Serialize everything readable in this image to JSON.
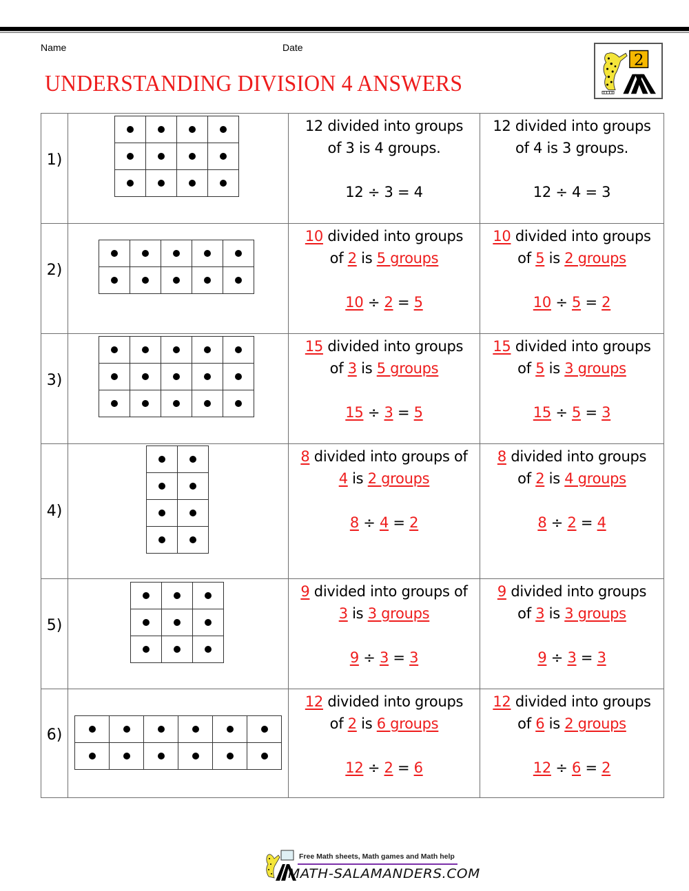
{
  "header": {
    "name_label": "Name",
    "date_label": "Date",
    "title": "UNDERSTANDING DIVISION 4 ANSWERS",
    "title_color": "#ee1c1c",
    "logo_icon": "salamander-math-logo",
    "logo_number": "2"
  },
  "answer_color": "#ee1c1c",
  "problems": [
    {
      "label": "1)",
      "array": {
        "rows": 3,
        "cols": 4
      },
      "answers_highlighted": false,
      "a": {
        "total": "12",
        "group": "3",
        "count": "4",
        "line1": "12 divided into groups",
        "line2": "of 3 is 4 groups.",
        "eq_total": "12",
        "eq_div": "3",
        "eq_res": "4"
      },
      "b": {
        "total": "12",
        "group": "4",
        "count": "3",
        "line1": "12 divided into groups",
        "line2": "of 4 is 3 groups.",
        "eq_total": "12",
        "eq_div": "4",
        "eq_res": "3"
      }
    },
    {
      "label": "2)",
      "array": {
        "rows": 2,
        "cols": 5
      },
      "answers_highlighted": true,
      "a": {
        "total": "10",
        "group": "2",
        "count_text": "5 groups",
        "eq_div": "2",
        "eq_res": "5"
      },
      "b": {
        "total": "10",
        "group": "5",
        "count_text": "2 groups",
        "eq_div": "5",
        "eq_res": "2"
      }
    },
    {
      "label": "3)",
      "array": {
        "rows": 3,
        "cols": 5
      },
      "answers_highlighted": true,
      "a": {
        "total": "15",
        "group": "3",
        "count_text": "5 groups",
        "eq_div": "3",
        "eq_res": "5"
      },
      "b": {
        "total": "15",
        "group": "5",
        "count_text": "3 groups",
        "eq_div": "5",
        "eq_res": "3"
      }
    },
    {
      "label": "4)",
      "array": {
        "rows": 4,
        "cols": 2
      },
      "answers_highlighted": true,
      "a": {
        "total": "8",
        "group": "4",
        "count_text": "2 groups",
        "eq_div": "4",
        "eq_res": "2"
      },
      "b": {
        "total": "8",
        "group": "2",
        "count_text": "4 groups",
        "eq_div": "2",
        "eq_res": "4"
      }
    },
    {
      "label": "5)",
      "array": {
        "rows": 3,
        "cols": 3
      },
      "answers_highlighted": true,
      "a": {
        "total": "9",
        "group": "3",
        "count_text": "3 groups",
        "eq_div": "3",
        "eq_res": "3"
      },
      "b": {
        "total": "9",
        "group": "3",
        "count_text": "3 groups",
        "eq_div": "3",
        "eq_res": "3"
      }
    },
    {
      "label": "6)",
      "array": {
        "rows": 2,
        "cols": 6
      },
      "answers_highlighted": true,
      "a": {
        "total": "12",
        "group": "2",
        "count_text": "6 groups",
        "eq_div": "2",
        "eq_res": "6"
      },
      "b": {
        "total": "12",
        "group": "6",
        "count_text": "2 groups",
        "eq_div": "6",
        "eq_res": "2"
      }
    }
  ],
  "phrases": {
    "divided_into_groups": "divided into groups",
    "divided_into_groups_of": "divided into groups of",
    "of": "of",
    "is": "is",
    "div_sign": "÷",
    "eq_sign": "="
  },
  "footer": {
    "tagline": "Free Math sheets, Math games and Math help",
    "site": "MATH-SALAMANDERS.COM",
    "line_color": "#7b2fa8"
  }
}
